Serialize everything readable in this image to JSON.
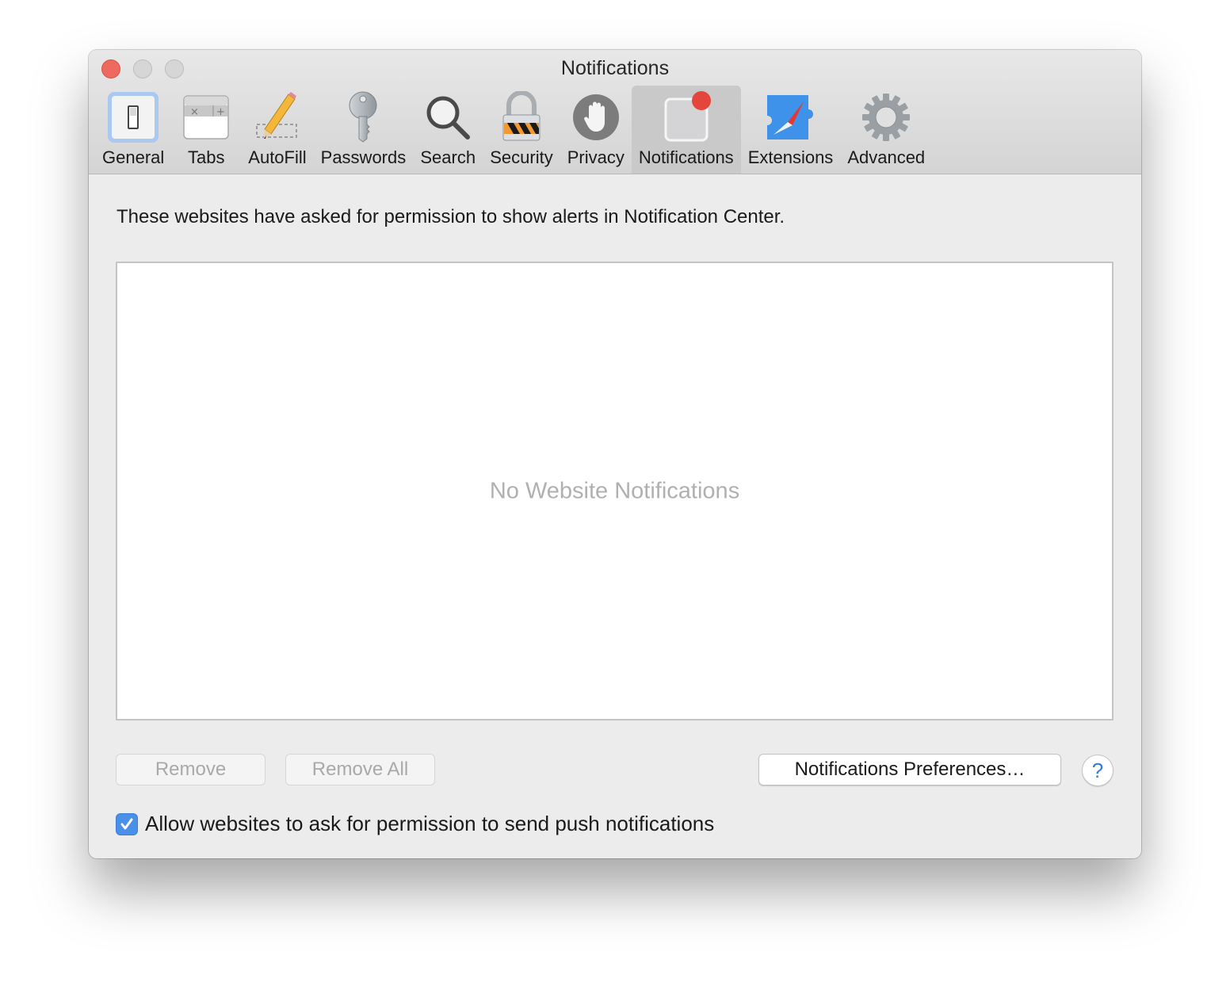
{
  "window": {
    "title": "Notifications"
  },
  "toolbar": {
    "items": [
      {
        "label": "General",
        "icon": "general-switch-icon",
        "active": false
      },
      {
        "label": "Tabs",
        "icon": "tabs-icon",
        "active": false
      },
      {
        "label": "AutoFill",
        "icon": "pencil-icon",
        "active": false
      },
      {
        "label": "Passwords",
        "icon": "key-icon",
        "active": false
      },
      {
        "label": "Search",
        "icon": "magnifier-icon",
        "active": false
      },
      {
        "label": "Security",
        "icon": "padlock-icon",
        "active": false
      },
      {
        "label": "Privacy",
        "icon": "hand-icon",
        "active": false
      },
      {
        "label": "Notifications",
        "icon": "notification-badge-icon",
        "active": true
      },
      {
        "label": "Extensions",
        "icon": "puzzle-compass-icon",
        "active": false
      },
      {
        "label": "Advanced",
        "icon": "gear-icon",
        "active": false
      }
    ]
  },
  "main": {
    "description": "These websites have asked for permission to show alerts in Notification Center.",
    "empty_message": "No Website Notifications",
    "remove_label": "Remove",
    "remove_all_label": "Remove All",
    "preferences_label": "Notifications Preferences…",
    "help_label": "?",
    "allow_checkbox": {
      "label": "Allow websites to ask for permission to send push notifications",
      "checked": true
    }
  },
  "colors": {
    "accent": "#4a90e9",
    "close": "#ee6a5e",
    "badge": "#e5463c"
  }
}
